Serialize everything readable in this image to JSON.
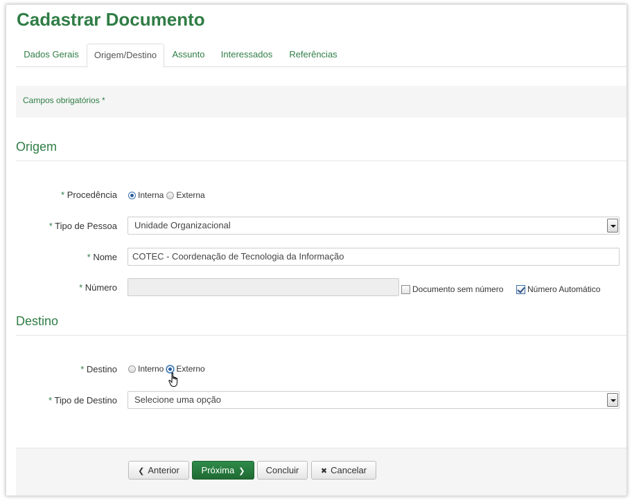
{
  "page": {
    "title": "Cadastrar Documento"
  },
  "tabs": [
    {
      "label": "Dados Gerais",
      "active": false
    },
    {
      "label": "Origem/Destino",
      "active": true
    },
    {
      "label": "Assunto",
      "active": false
    },
    {
      "label": "Interessados",
      "active": false
    },
    {
      "label": "Referências",
      "active": false
    }
  ],
  "notice": {
    "required_fields": "Campos obrigatórios *"
  },
  "origem": {
    "heading": "Origem",
    "required_mark": "*",
    "procedencia": {
      "label": "Procedência",
      "options": [
        "Interna",
        "Externa"
      ],
      "selected": "Interna"
    },
    "tipo_pessoa": {
      "label": "Tipo de Pessoa",
      "value": "Unidade Organizacional"
    },
    "nome": {
      "label": "Nome",
      "value": "COTEC - Coordenação de Tecnologia da Informação"
    },
    "numero": {
      "label": "Número",
      "value": "",
      "sem_numero": {
        "label": "Documento sem número",
        "checked": false
      },
      "automatico": {
        "label": "Número Automático",
        "checked": true
      }
    }
  },
  "destino": {
    "heading": "Destino",
    "required_mark": "*",
    "destino": {
      "label": "Destino",
      "options": [
        "Interno",
        "Externo"
      ],
      "selected": "Externo"
    },
    "tipo_destino": {
      "label": "Tipo de Destino",
      "value": "Selecione uma opção"
    }
  },
  "actions": {
    "anterior": "Anterior",
    "proxima": "Próxima",
    "concluir": "Concluir",
    "cancelar": "Cancelar"
  },
  "colors": {
    "accent": "#2f7d45",
    "primary_button": "#237a3b"
  },
  "icons": {
    "anterior": "chevron-left-icon",
    "proxima": "chevron-right-icon",
    "cancelar": "close-icon",
    "cursor": "hand-pointer-icon"
  }
}
